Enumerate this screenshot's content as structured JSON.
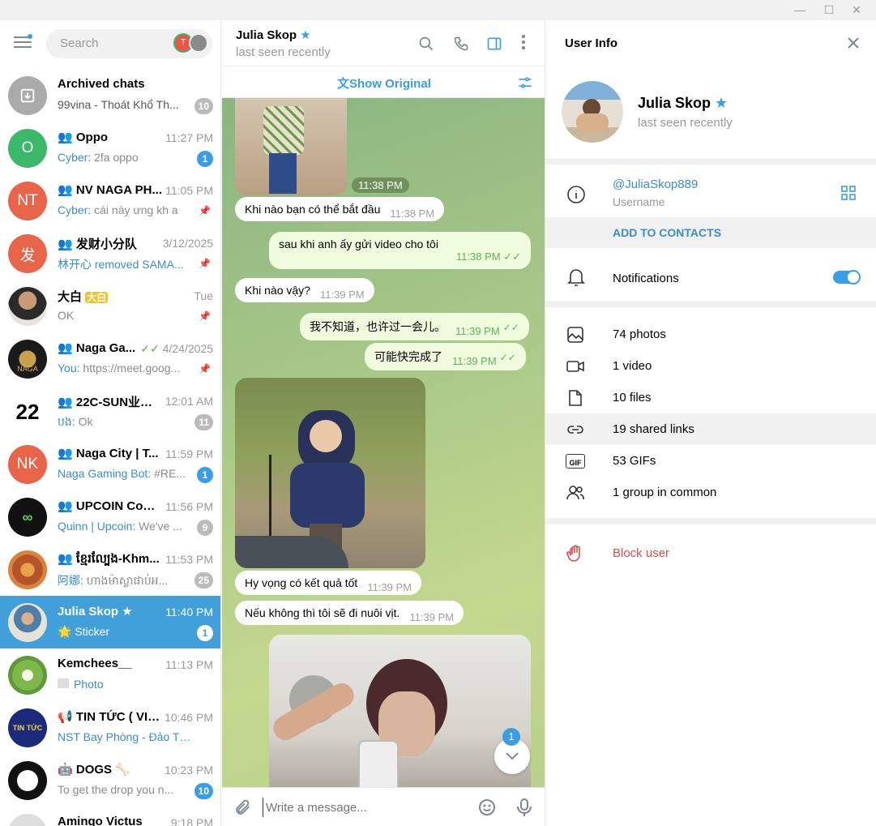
{
  "left_panel": {
    "search_placeholder": "Search",
    "chats": [
      {
        "name": "Archived chats",
        "preview": "99vina - Thoát Khổ Th...",
        "badge": "10",
        "muted": true
      },
      {
        "name": "Oppo",
        "group": true,
        "time": "11:27 PM",
        "sender": "Cyber:",
        "preview": "2fa oppo",
        "badge": "1"
      },
      {
        "name": "NV NAGA PH...",
        "group": true,
        "time": "11:05 PM",
        "sender": "Cyber:",
        "preview": "cái này ưng kh a",
        "pinned": true
      },
      {
        "name": "发财小分队",
        "group": true,
        "time": "3/12/2025",
        "preview": "林开心 removed SAMA...",
        "pinned": true
      },
      {
        "name": "大白",
        "time": "Tue",
        "preview": "OK",
        "pinned": true
      },
      {
        "name": "Naga Ga...",
        "group": true,
        "time": "4/24/2025",
        "sender": "You:",
        "preview": "https://meet.goog...",
        "pinned": true
      },
      {
        "name": "22C-SUN业主群",
        "group": true,
        "time": "12:01 AM",
        "sender": "បង:",
        "preview": "Ok",
        "badge": "11",
        "muted": true
      },
      {
        "name": "Naga City | T...",
        "group": true,
        "time": "11:59 PM",
        "sender": "Naga Gaming Bot:",
        "preview": "#RE...",
        "badge": "1"
      },
      {
        "name": "UPCOIN Com...",
        "group": true,
        "time": "11:56 PM",
        "sender": "Quinn | Upcoin:",
        "preview": "We've ...",
        "badge": "9",
        "muted": true
      },
      {
        "name": "ខ្មែរល្បែង-Khm...",
        "group": true,
        "time": "11:53 PM",
        "sender": "阿娜:",
        "preview": "ហាងម៉ាស្លាផាប់អ...",
        "badge": "25",
        "muted": true
      },
      {
        "name": "Julia Skop",
        "time": "11:40 PM",
        "preview": "🌟 Sticker",
        "badge": "1",
        "active": true
      },
      {
        "name": "Kemchees__",
        "time": "11:13 PM",
        "preview": "Photo"
      },
      {
        "name": "TIN TỨC ( VIỆ...",
        "channel": true,
        "time": "10:46 PM",
        "preview": "NST Bay Phòng - Đảo Thiê..."
      },
      {
        "name": "DOGS 🦴",
        "group": true,
        "time": "10:23 PM",
        "preview": "To get the drop you n...",
        "badge": "10",
        "muted": true
      },
      {
        "name": "Amingo Victus",
        "time": "9:18 PM",
        "preview": ""
      }
    ],
    "avatars": {
      "oppo": "O",
      "nv": "NT",
      "fa": "发",
      "twenty2": "22",
      "nk": "NK"
    }
  },
  "chat_header": {
    "name": "Julia Skop",
    "status": "last seen recently"
  },
  "translate": {
    "label": "Show Original"
  },
  "messages": [
    {
      "time": "11:38 PM",
      "type": "photo-time"
    },
    {
      "text": "Khi nào bạn có thể bắt đầu",
      "time": "11:38 PM",
      "out": false
    },
    {
      "text": "sau khi anh ấy gửi video cho tôi",
      "time": "11:38 PM",
      "out": true
    },
    {
      "text": "Khi nào vậy?",
      "time": "11:39 PM",
      "out": false
    },
    {
      "text": "我不知道，也许过一会儿。",
      "time": "11:39 PM",
      "out": true
    },
    {
      "text": "可能快完成了",
      "time": "11:39 PM",
      "out": true
    },
    {
      "text": "Hy vọng có kết quả tốt",
      "time": "11:39 PM",
      "out": false
    },
    {
      "text": "Nếu không thì tôi sẽ đi nuôi vịt.",
      "time": "11:39 PM",
      "out": false
    }
  ],
  "scroll_badge": "1",
  "compose": {
    "placeholder": "Write a message..."
  },
  "user_info": {
    "title": "User Info",
    "name": "Julia Skop",
    "status": "last seen recently",
    "username": "@JuliaSkop889",
    "username_label": "Username",
    "add_contacts": "ADD TO CONTACTS",
    "notifications": "Notifications",
    "notifications_on": true,
    "media": [
      {
        "icon": "photo-icon",
        "label": "74 photos"
      },
      {
        "icon": "video-icon",
        "label": "1 video"
      },
      {
        "icon": "file-icon",
        "label": "10 files"
      },
      {
        "icon": "link-icon",
        "label": "19 shared links"
      },
      {
        "icon": "gif-icon",
        "label": "53 GIFs"
      },
      {
        "icon": "group-icon",
        "label": "1 group in common"
      }
    ],
    "block": "Block user"
  },
  "colors": {
    "accent": "#419fd9",
    "badge": "#3a9ee6",
    "danger": "#d94c4c",
    "out_bubble": "#effdde"
  }
}
